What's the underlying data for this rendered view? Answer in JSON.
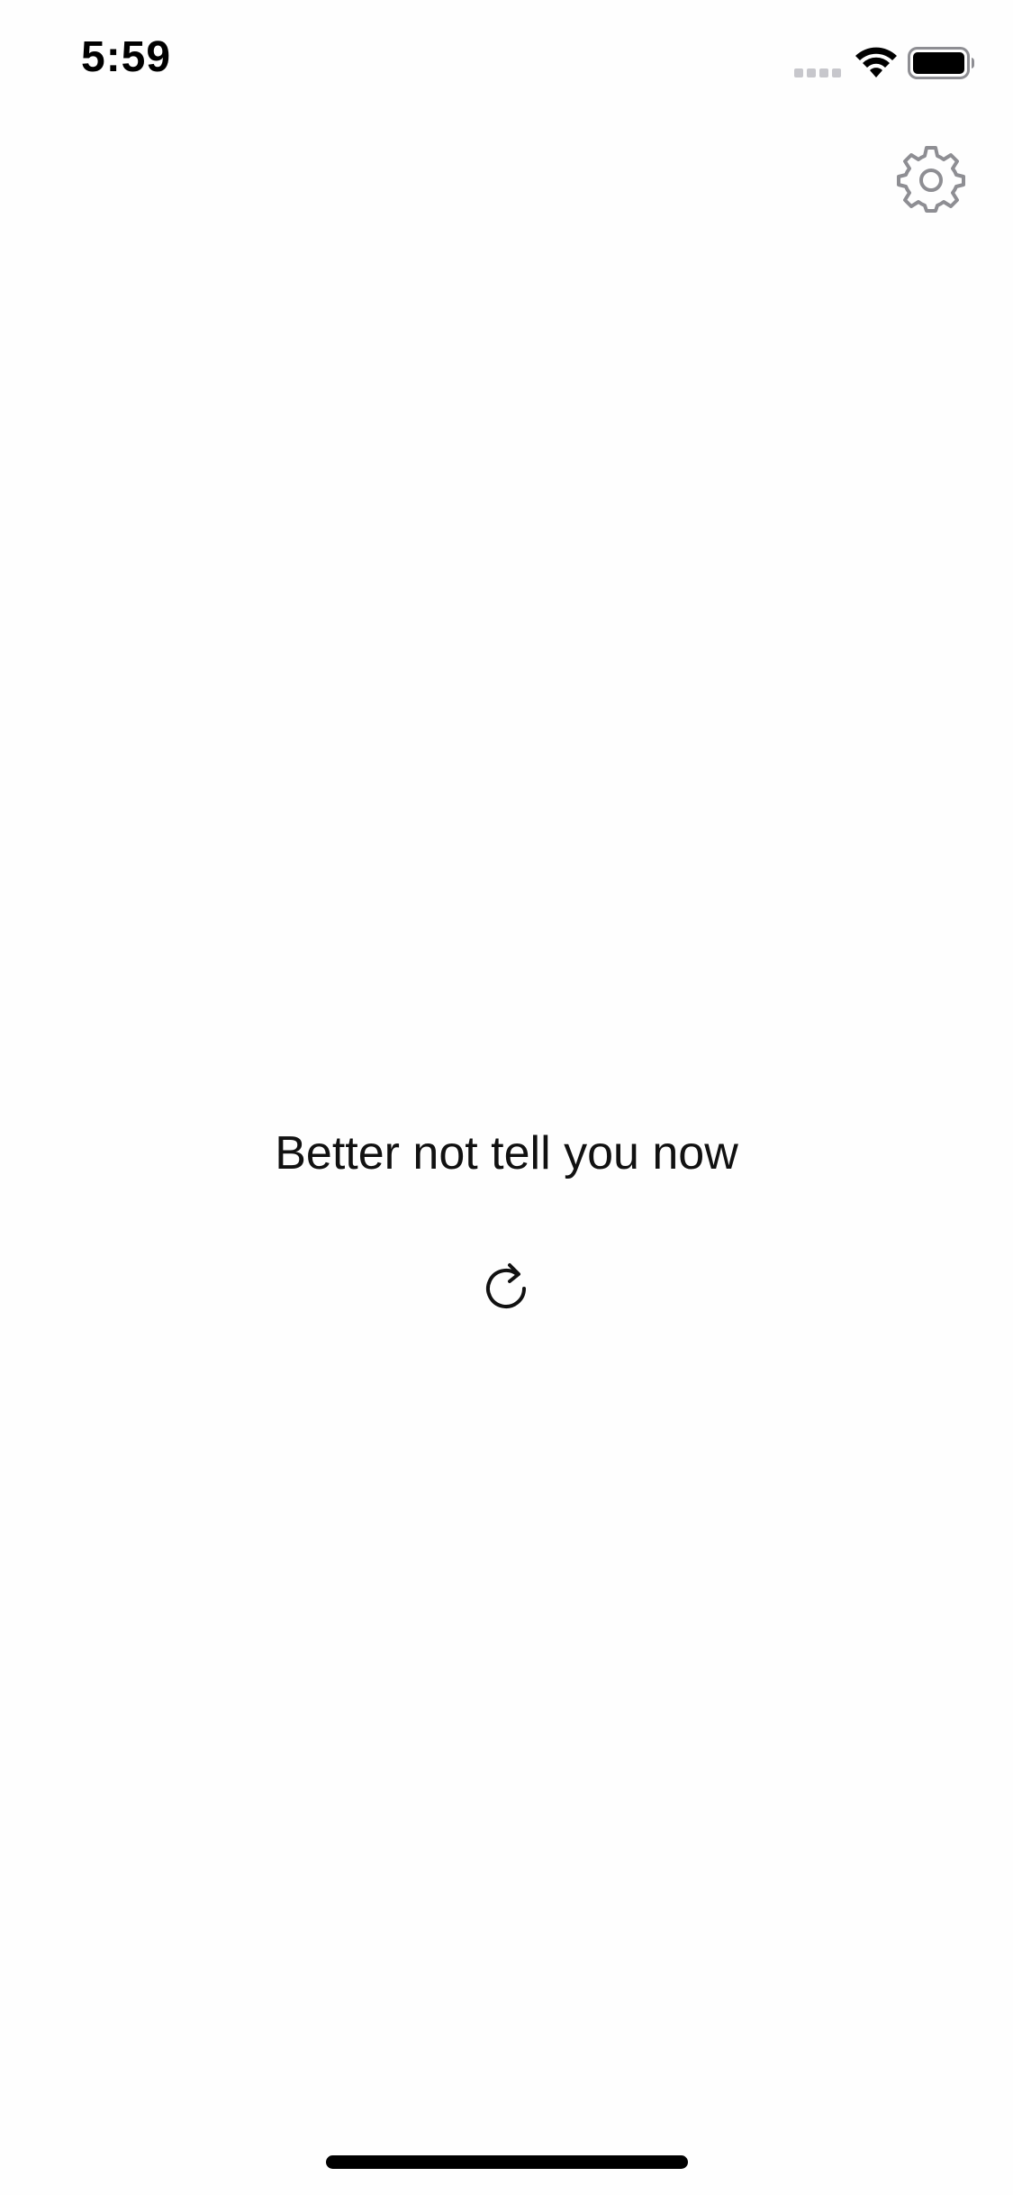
{
  "status_bar": {
    "time": "5:59"
  },
  "icons": {
    "signal": "cellular-signal-icon",
    "wifi": "wifi-icon",
    "battery": "battery-icon",
    "settings": "gear-icon",
    "refresh": "refresh-icon"
  },
  "main": {
    "answer": "Better not tell you now"
  },
  "colors": {
    "background": "#fefefe",
    "text": "#111111",
    "gear": "#8e8e93",
    "signal_inactive": "#c7c7cc"
  }
}
